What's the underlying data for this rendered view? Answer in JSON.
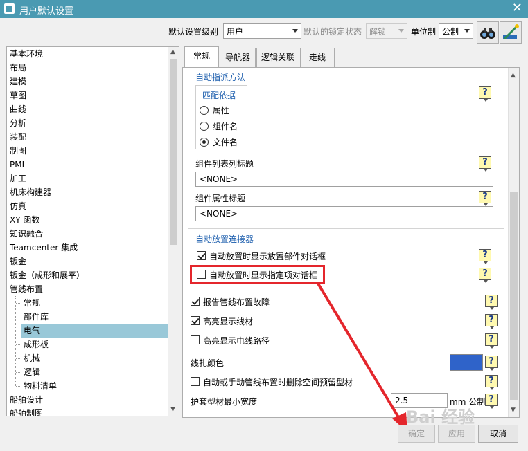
{
  "window": {
    "title": "用户默认设置",
    "close": "✕"
  },
  "toolbar": {
    "level_label": "默认设置级别",
    "level_value": "用户",
    "lock_label": "默认的锁定状态",
    "lock_value": "解锁",
    "unit_label": "单位制",
    "unit_value": "公制"
  },
  "tree": {
    "items": [
      {
        "label": "基本环境"
      },
      {
        "label": "布局"
      },
      {
        "label": "建模"
      },
      {
        "label": "草图"
      },
      {
        "label": "曲线"
      },
      {
        "label": "分析"
      },
      {
        "label": "装配"
      },
      {
        "label": "制图"
      },
      {
        "label": "PMI"
      },
      {
        "label": "加工"
      },
      {
        "label": "机床构建器"
      },
      {
        "label": "仿真"
      },
      {
        "label": "XY 函数"
      },
      {
        "label": "知识融合"
      },
      {
        "label": "Teamcenter 集成"
      },
      {
        "label": "钣金"
      },
      {
        "label": "钣金（成形和展平）"
      },
      {
        "label": "管线布置"
      }
    ],
    "subitems": [
      {
        "label": "常规"
      },
      {
        "label": "部件库"
      },
      {
        "label": "电气"
      },
      {
        "label": "成形板"
      },
      {
        "label": "机械"
      },
      {
        "label": "逻辑"
      },
      {
        "label": "物料清单"
      }
    ],
    "after": [
      {
        "label": "船舶设计"
      },
      {
        "label": "船舶制图"
      }
    ],
    "selected": "电气"
  },
  "tabs": [
    {
      "label": "常规"
    },
    {
      "label": "导航器"
    },
    {
      "label": "逻辑关联"
    },
    {
      "label": "走线"
    }
  ],
  "panel": {
    "auto_assign_title": "自动指派方法",
    "match_group_title": "匹配依据",
    "radio_attr": "属性",
    "radio_compname": "组件名",
    "radio_filename": "文件名",
    "col_title_label": "组件列表列标题",
    "col_title_value": "<NONE>",
    "attr_title_label": "组件属性标题",
    "attr_title_value": "<NONE>",
    "auto_place_title": "自动放置连接器",
    "cb_show_place_part": "自动放置时显示放置部件对话框",
    "cb_show_specified": "自动放置时显示指定项对话框",
    "cb_report_fault": "报告管线布置故障",
    "cb_highlight_wire": "高亮显示线材",
    "cb_highlight_path": "高亮显示电线路径",
    "harness_color_label": "线扎颜色",
    "harness_color": "#2f63c9",
    "cb_delete_reserved": "自动或手动管线布置时删除空间预留型材",
    "sheath_min_label": "护套型材最小宽度",
    "sheath_min_value": "2.5",
    "sheath_unit": "mm 公制",
    "help_glyph": "?"
  },
  "buttons": {
    "ok": "确定",
    "apply": "应用",
    "cancel": "取消"
  },
  "watermark": "Bai 经验",
  "icons": [
    "binoculars-icon",
    "settings-wand-icon",
    "help-icon",
    "close-icon"
  ]
}
